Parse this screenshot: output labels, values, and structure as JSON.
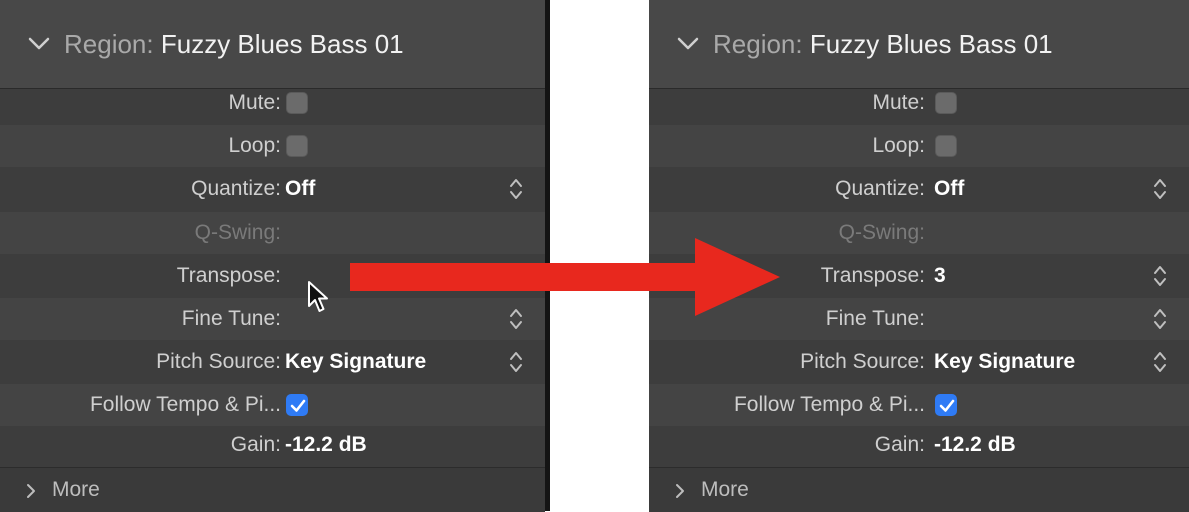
{
  "panels": [
    {
      "header": {
        "prefix": "Region:",
        "name": "Fuzzy Blues Bass 01"
      },
      "rows": {
        "mute": {
          "label": "Mute:",
          "checked": false
        },
        "loop": {
          "label": "Loop:",
          "checked": false
        },
        "quantize": {
          "label": "Quantize:",
          "value": "Off"
        },
        "qswing": {
          "label": "Q-Swing:",
          "value": ""
        },
        "transpose": {
          "label": "Transpose:",
          "value": ""
        },
        "finetune": {
          "label": "Fine Tune:",
          "value": ""
        },
        "pitchsource": {
          "label": "Pitch Source:",
          "value": "Key Signature"
        },
        "follow": {
          "label": "Follow Tempo & Pi...",
          "checked": true
        },
        "gain": {
          "label": "Gain:",
          "value": "-12.2 dB"
        }
      },
      "more": {
        "label": "More"
      }
    },
    {
      "header": {
        "prefix": "Region:",
        "name": "Fuzzy Blues Bass 01"
      },
      "rows": {
        "mute": {
          "label": "Mute:",
          "checked": false
        },
        "loop": {
          "label": "Loop:",
          "checked": false
        },
        "quantize": {
          "label": "Quantize:",
          "value": "Off"
        },
        "qswing": {
          "label": "Q-Swing:",
          "value": ""
        },
        "transpose": {
          "label": "Transpose:",
          "value": "3"
        },
        "finetune": {
          "label": "Fine Tune:",
          "value": ""
        },
        "pitchsource": {
          "label": "Pitch Source:",
          "value": "Key Signature"
        },
        "follow": {
          "label": "Follow Tempo & Pi...",
          "checked": true
        },
        "gain": {
          "label": "Gain:",
          "value": "-12.2 dB"
        }
      },
      "more": {
        "label": "More"
      }
    }
  ],
  "colors": {
    "panel_bg": "#3d3d3d",
    "checkbox_accent": "#2f7bf5",
    "arrow": "#e8281e"
  },
  "icons": {
    "collapse": "chevron-down-icon",
    "expand": "chevron-right-icon",
    "stepper": "up-down-stepper-icon",
    "pointer": "mouse-pointer-icon",
    "arrow": "red-arrow-icon"
  }
}
